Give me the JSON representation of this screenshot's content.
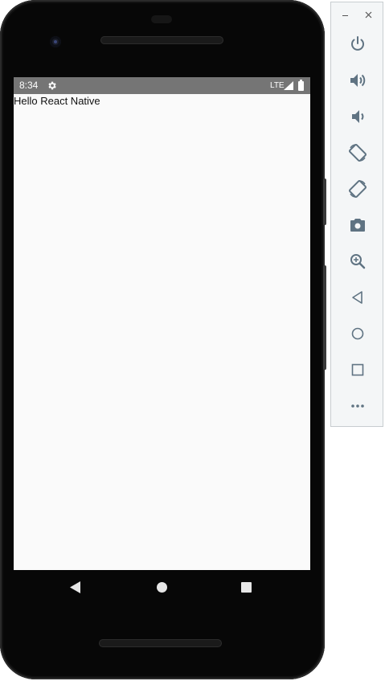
{
  "status_bar": {
    "time": "8:34",
    "network": "LTE",
    "icons": [
      "gear-icon",
      "signal-icon",
      "battery-icon"
    ]
  },
  "app": {
    "text": "Hello React Native"
  },
  "nav_bar": {
    "buttons": [
      "back-icon",
      "home-icon",
      "recents-icon"
    ]
  },
  "toolbar": {
    "window_controls": [
      "minimize-icon",
      "close-icon"
    ],
    "buttons": [
      "power-icon",
      "volume-up-icon",
      "volume-down-icon",
      "rotate-left-icon",
      "rotate-right-icon",
      "camera-icon",
      "zoom-icon",
      "back-icon",
      "home-icon",
      "overview-icon",
      "more-icon"
    ]
  },
  "colors": {
    "status_bar": "#757575",
    "screen_bg": "#fafafa",
    "toolbar_icon": "#5f7382"
  }
}
